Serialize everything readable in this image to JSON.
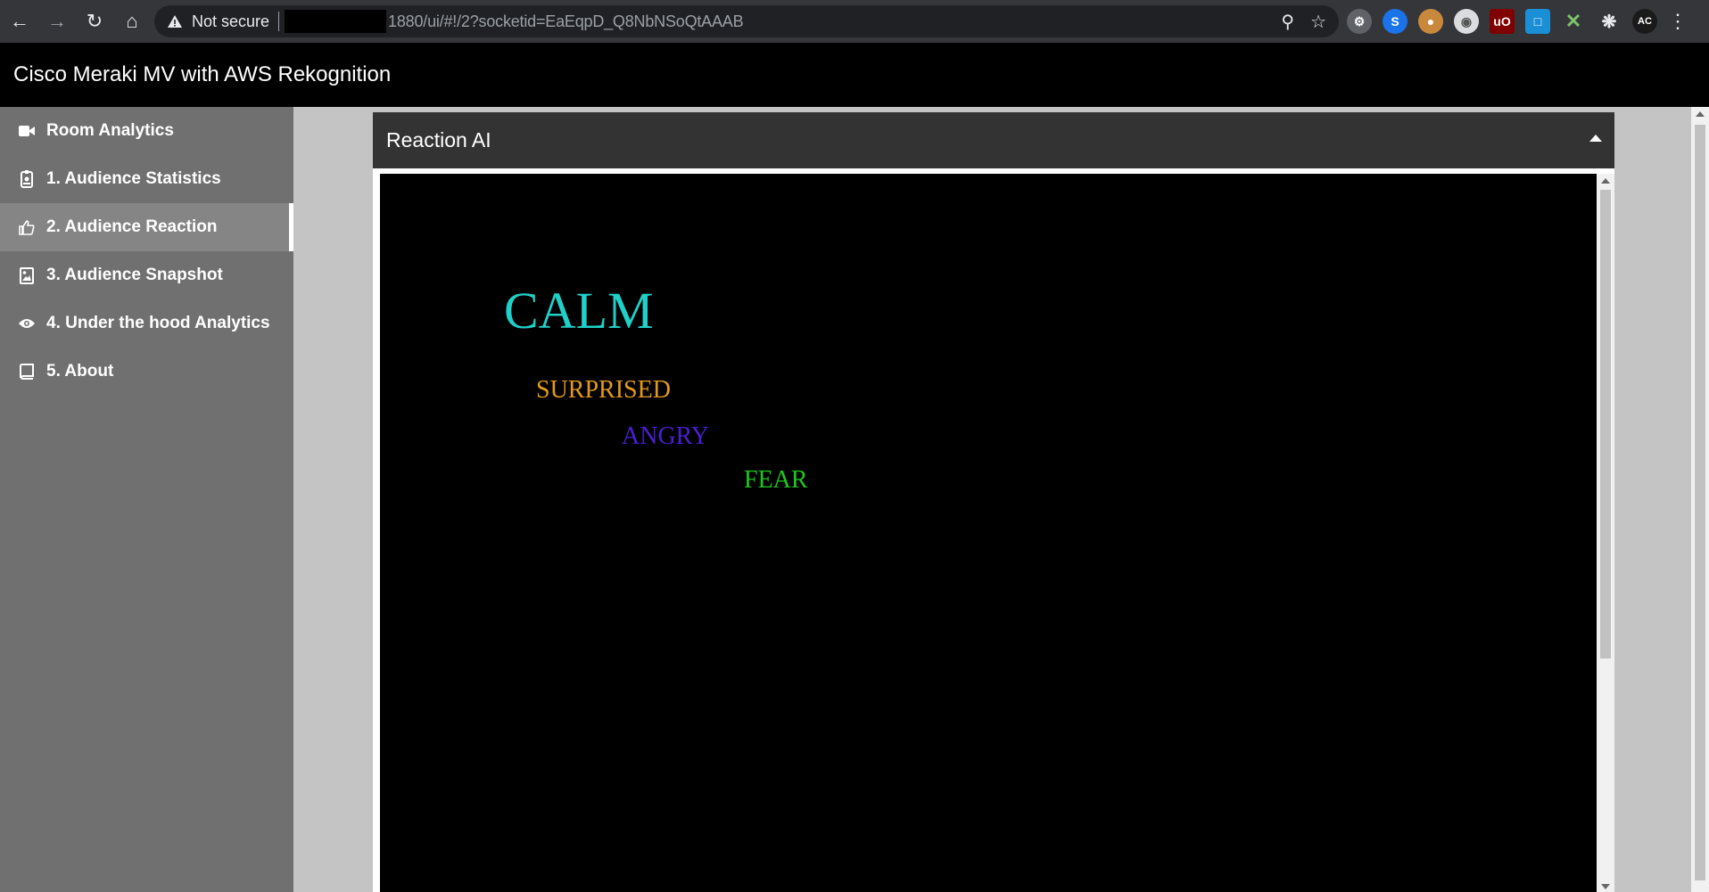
{
  "browser": {
    "security_label": "Not secure",
    "url": "1880/ui/#!/2?socketid=EaEqpD_Q8NbNSoQtAAAB",
    "profile_initials": "AC"
  },
  "app": {
    "title": "Cisco Meraki MV with AWS Rekognition"
  },
  "sidebar": {
    "items": [
      {
        "label": "Room Analytics",
        "icon": "video-camera-icon"
      },
      {
        "label": "1. Audience Statistics",
        "icon": "id-badge-icon"
      },
      {
        "label": "2. Audience Reaction",
        "icon": "thumbs-up-icon",
        "active": true
      },
      {
        "label": "3. Audience Snapshot",
        "icon": "image-icon"
      },
      {
        "label": "4. Under the hood Analytics",
        "icon": "eye-icon"
      },
      {
        "label": "5. About",
        "icon": "book-icon"
      }
    ]
  },
  "panel": {
    "title": "Reaction AI",
    "words": [
      {
        "text": "CALM",
        "color": "#20d0c8"
      },
      {
        "text": "SURPRISED",
        "color": "#e39a1b"
      },
      {
        "text": "ANGRY",
        "color": "#4a1fd1"
      },
      {
        "text": "FEAR",
        "color": "#1ec81e"
      }
    ]
  }
}
